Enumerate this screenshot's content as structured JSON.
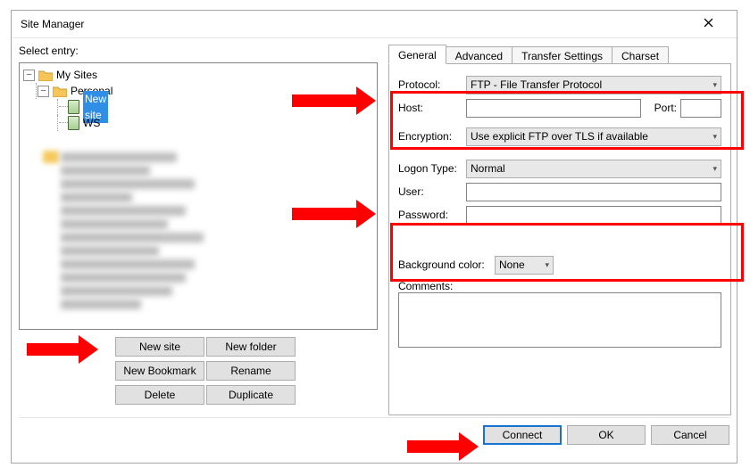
{
  "title": "Site Manager",
  "select_label": "Select entry:",
  "tree": {
    "root": "My Sites",
    "folder": "Personal",
    "site_selected": "New site",
    "site_ws": "WS"
  },
  "buttons": {
    "new_site": "New site",
    "new_folder": "New folder",
    "new_bookmark": "New Bookmark",
    "rename": "Rename",
    "delete": "Delete",
    "duplicate": "Duplicate"
  },
  "tabs": {
    "general": "General",
    "advanced": "Advanced",
    "transfer": "Transfer Settings",
    "charset": "Charset"
  },
  "form": {
    "protocol_label": "Protocol:",
    "protocol_value": "FTP - File Transfer Protocol",
    "host_label": "Host:",
    "host_value": "",
    "port_label": "Port:",
    "port_value": "",
    "encryption_label": "Encryption:",
    "encryption_value": "Use explicit FTP over TLS if available",
    "logon_label": "Logon Type:",
    "logon_value": "Normal",
    "user_label": "User:",
    "user_value": "",
    "password_label": "Password:",
    "password_value": "",
    "bg_label": "Background color:",
    "bg_value": "None",
    "comments_label": "Comments:",
    "comments_value": ""
  },
  "footer": {
    "connect": "Connect",
    "ok": "OK",
    "cancel": "Cancel"
  }
}
